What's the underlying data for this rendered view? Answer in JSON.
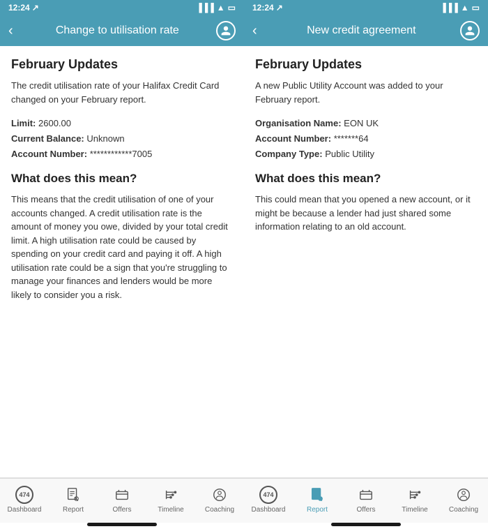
{
  "screens": [
    {
      "id": "screen-left",
      "statusBar": {
        "time": "12:24",
        "arrow": "↗"
      },
      "header": {
        "title": "Change to utilisation rate",
        "backLabel": "‹"
      },
      "content": {
        "sectionTitle": "February Updates",
        "intro": "The credit utilisation rate of your Halifax Credit Card changed on your February report.",
        "details": [
          {
            "label": "Limit:",
            "value": "2600.00"
          },
          {
            "label": "Current Balance:",
            "value": "Unknown"
          },
          {
            "label": "Account Number:",
            "value": "************7005"
          }
        ],
        "whatTitle": "What does this mean?",
        "explanation": "This means that the credit utilisation of one of your accounts changed. A credit utilisation rate is the amount of money you owe, divided by your total credit limit. A high utilisation rate could be caused by spending on your credit card and paying it off. A high utilisation rate could be a sign that you're struggling to manage your finances and lenders would be more likely to consider you a risk."
      },
      "nav": {
        "items": [
          {
            "id": "dashboard",
            "label": "Dashboard",
            "type": "badge",
            "badge": "474",
            "active": false
          },
          {
            "id": "report",
            "label": "Report",
            "type": "report",
            "active": false
          },
          {
            "id": "offers",
            "label": "Offers",
            "type": "offers",
            "active": false
          },
          {
            "id": "timeline",
            "label": "Timeline",
            "type": "timeline",
            "active": false
          },
          {
            "id": "coaching",
            "label": "Coaching",
            "type": "coaching",
            "active": false
          }
        ]
      }
    },
    {
      "id": "screen-right",
      "statusBar": {
        "time": "12:24",
        "arrow": "↗"
      },
      "header": {
        "title": "New credit agreement",
        "backLabel": "‹"
      },
      "content": {
        "sectionTitle": "February Updates",
        "intro": "A new Public Utility Account was added to your February report.",
        "details": [
          {
            "label": "Organisation Name:",
            "value": "EON UK"
          },
          {
            "label": "Account Number:",
            "value": "*******64"
          },
          {
            "label": "Company Type:",
            "value": "Public Utility"
          }
        ],
        "whatTitle": "What does this mean?",
        "explanation": "This could mean that you opened a new account, or it might be because a lender had just shared some information relating to an old account."
      },
      "nav": {
        "items": [
          {
            "id": "dashboard",
            "label": "Dashboard",
            "type": "badge",
            "badge": "474",
            "active": false
          },
          {
            "id": "report",
            "label": "Report",
            "type": "report",
            "active": true
          },
          {
            "id": "offers",
            "label": "Offers",
            "type": "offers",
            "active": false
          },
          {
            "id": "timeline",
            "label": "Timeline",
            "type": "timeline",
            "active": false
          },
          {
            "id": "coaching",
            "label": "Coaching",
            "type": "coaching",
            "active": false
          }
        ]
      }
    }
  ]
}
